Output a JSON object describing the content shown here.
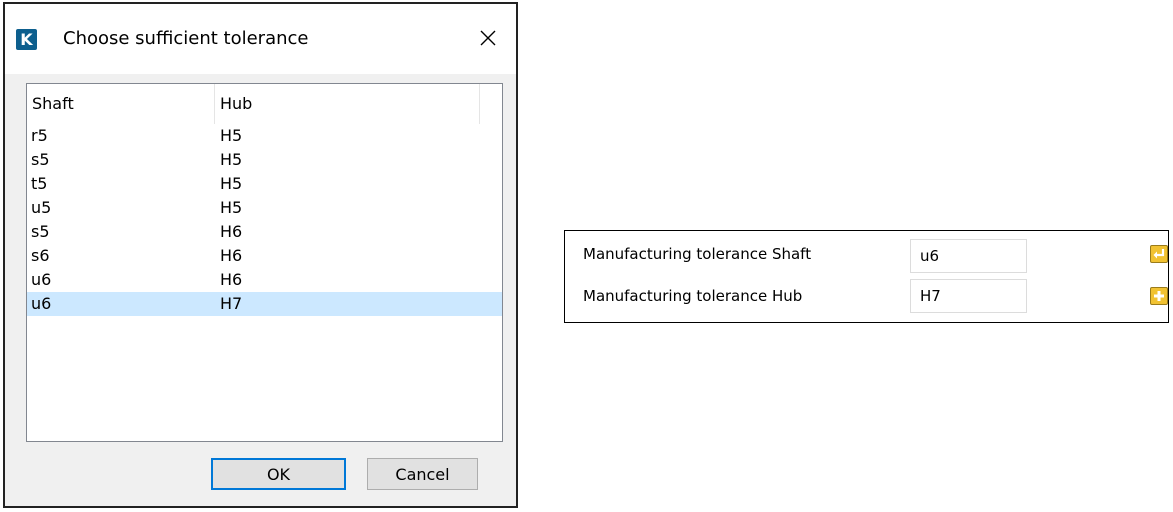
{
  "dialog": {
    "logo_letter": "K",
    "title": "Choose sufficient tolerance",
    "columns": {
      "shaft": "Shaft",
      "hub": "Hub"
    },
    "rows": [
      {
        "shaft": "r5",
        "hub": "H5"
      },
      {
        "shaft": "s5",
        "hub": "H5"
      },
      {
        "shaft": "t5",
        "hub": "H5"
      },
      {
        "shaft": "u5",
        "hub": "H5"
      },
      {
        "shaft": "s5",
        "hub": "H6"
      },
      {
        "shaft": "s6",
        "hub": "H6"
      },
      {
        "shaft": "u6",
        "hub": "H6"
      },
      {
        "shaft": "u6",
        "hub": "H7"
      }
    ],
    "selected_row": 7,
    "ok_label": "OK",
    "cancel_label": "Cancel"
  },
  "panel": {
    "shaft_label": "Manufacturing tolerance Shaft",
    "shaft_value": "u6",
    "hub_label": "Manufacturing tolerance Hub",
    "hub_value": "H7",
    "shaft_button_icon": "enter-arrow-icon",
    "hub_button_icon": "plus-icon"
  },
  "colors": {
    "logo": "#0d5f8e",
    "selection": "#cce8ff",
    "default_button_border": "#0078d7",
    "icon_button": "#f1c232"
  }
}
